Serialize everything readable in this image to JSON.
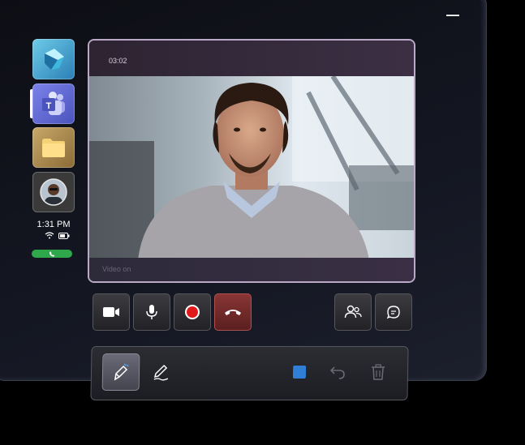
{
  "sidebar": {
    "apps": [
      {
        "name": "Dynamics 365 Guides",
        "icon": "dynamics-icon"
      },
      {
        "name": "Microsoft Teams",
        "icon": "teams-icon",
        "badge": "T"
      },
      {
        "name": "Files",
        "icon": "folder-icon"
      },
      {
        "name": "Contact",
        "icon": "avatar-icon"
      }
    ],
    "time": "1:31 PM",
    "status_icons": [
      "wifi-icon",
      "battery-icon"
    ],
    "call_indicator": "phone-icon"
  },
  "video": {
    "timer": "03:02",
    "caption": "Video on"
  },
  "call_controls": {
    "buttons": [
      {
        "name": "camera-button",
        "icon": "video-camera-icon"
      },
      {
        "name": "microphone-button",
        "icon": "microphone-icon"
      },
      {
        "name": "record-button",
        "icon": "record-icon"
      },
      {
        "name": "hang-up-button",
        "icon": "hang-up-icon"
      },
      {
        "name": "participants-button",
        "icon": "people-icon"
      },
      {
        "name": "chat-button",
        "icon": "chat-icon"
      }
    ]
  },
  "annotation_toolbar": {
    "tools": [
      "annotation-pen-icon",
      "pen-icon",
      "color-swatch-icon",
      "undo-icon",
      "delete-icon"
    ],
    "colors": {
      "swatch": "#2f7fd6"
    }
  },
  "colors": {
    "hangup": "#8a3535",
    "record": "#e01a1a",
    "call_pill": "#2ea84a",
    "frame_border": "#b9a9c6"
  }
}
